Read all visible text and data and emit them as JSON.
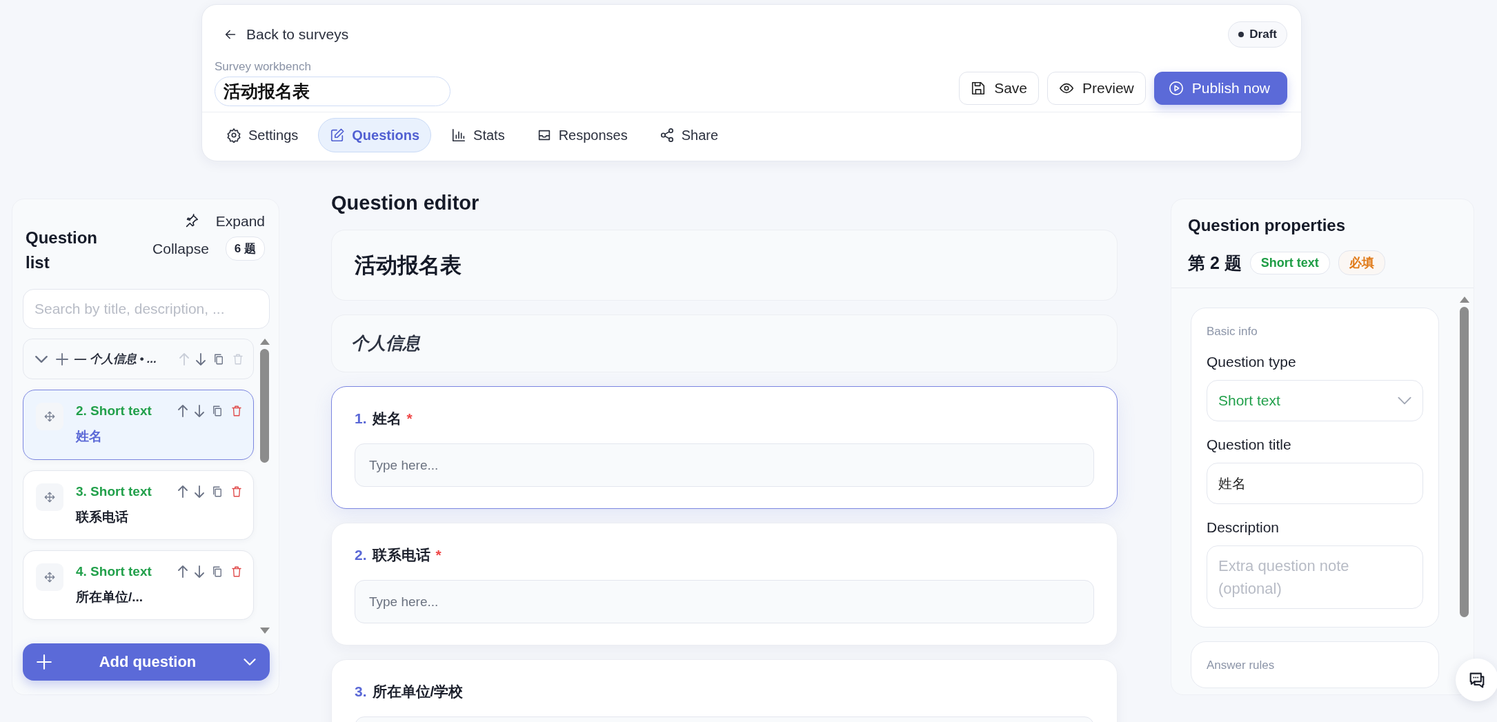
{
  "header": {
    "back_link": "Back to surveys",
    "status": {
      "label": "Draft"
    },
    "subtitle": "Survey workbench",
    "title_value": "活动报名表",
    "actions": [
      {
        "label": "Save",
        "kind": "save"
      },
      {
        "label": "Preview",
        "kind": "preview"
      },
      {
        "label": "Publish now",
        "kind": "publish"
      }
    ]
  },
  "tabs": [
    {
      "label": "Settings",
      "selected": false
    },
    {
      "label": "Questions",
      "selected": true
    },
    {
      "label": "Stats",
      "selected": false
    },
    {
      "label": "Responses",
      "selected": false
    },
    {
      "label": "Share",
      "selected": false
    }
  ],
  "question_list": {
    "title": "Question list",
    "expand": "Expand",
    "collapse": "Collapse",
    "count": "6 题",
    "search": {
      "placeholder": "Search by title, description, ..."
    },
    "items": [
      {
        "kind": "section",
        "title": "— 个人信息 • ...",
        "selected": false,
        "up_disabled": true,
        "delete_disabled": true
      },
      {
        "kind": "question",
        "type_label": "2. Short text",
        "title": "姓名",
        "selected": true,
        "up_disabled": false,
        "delete_disabled": false
      },
      {
        "kind": "question",
        "type_label": "3. Short text",
        "title": "联系电话",
        "selected": false,
        "up_disabled": false,
        "delete_disabled": false
      },
      {
        "kind": "question",
        "type_label": "4. Short text",
        "title": "所在单位/...",
        "selected": false,
        "up_disabled": false,
        "delete_disabled": false
      }
    ],
    "add_button": "Add question"
  },
  "editor": {
    "heading": "Question editor",
    "survey_title": "活动报名表",
    "section_title": "个人信息",
    "questions": [
      {
        "number": "1.",
        "title": "姓名",
        "required_mark": "*",
        "selected": true,
        "placeholder": "Type here..."
      },
      {
        "number": "2.",
        "title": "联系电话",
        "required_mark": "*",
        "selected": false,
        "placeholder": "Type here..."
      },
      {
        "number": "3.",
        "title": "所在单位/学校",
        "selected": false
      }
    ]
  },
  "properties": {
    "title": "Question properties",
    "question_label": "第 2 题",
    "type_tag": "Short text",
    "required_tag": "必填",
    "basic": {
      "title": "Basic info",
      "type_label": "Question type",
      "type_value": "Short text",
      "title_label": "Question title",
      "title_value": "姓名",
      "description_label": "Description",
      "description_placeholder": "Extra question note (optional)"
    },
    "rules": {
      "title": "Answer rules"
    }
  }
}
